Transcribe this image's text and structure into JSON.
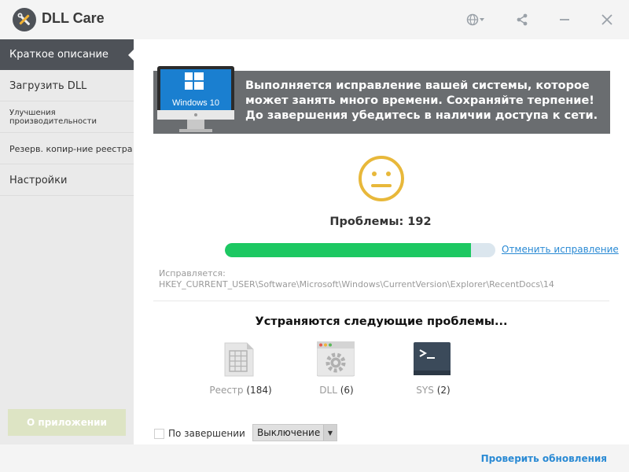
{
  "app": {
    "title": "DLL Care",
    "logo_icon": "wrench-screwdriver-icon"
  },
  "titlebar": {
    "language_icon": "globe-icon",
    "share_icon": "share-icon",
    "minimize_icon": "minimize-icon",
    "close_icon": "close-icon"
  },
  "sidebar": {
    "items": [
      {
        "label": "Краткое описание",
        "active": true
      },
      {
        "label": "Загрузить DLL",
        "active": false
      },
      {
        "label": "Улучшения производительности",
        "active": false
      },
      {
        "label": "Резерв. копир-ние реестра",
        "active": false
      },
      {
        "label": "Настройки",
        "active": false
      }
    ],
    "about_label": "О приложении"
  },
  "banner": {
    "monitor_text": "Windows 10",
    "message": "Выполняется исправление вашей системы, которое может занять много времени. Сохраняйте терпение! До завершения убедитесь в наличии доступа к сети."
  },
  "status": {
    "face_icon": "neutral-face-icon",
    "problems_label": "Проблемы: 192",
    "progress": 0.91,
    "cancel_label": "Отменить исправление",
    "fixing_label": "Исправляется:",
    "fixing_path": "HKEY_CURRENT_USER\\Software\\Microsoft\\Windows\\CurrentVersion\\Explorer\\RecentDocs\\14"
  },
  "issues": {
    "title": "Устраняются следующие проблемы...",
    "categories": [
      {
        "name": "Реестр",
        "count": "(184)",
        "icon": "registry-icon"
      },
      {
        "name": "DLL",
        "count": "(6)",
        "icon": "dll-gear-icon"
      },
      {
        "name": "SYS",
        "count": "(2)",
        "icon": "terminal-icon"
      }
    ]
  },
  "footer": {
    "on_complete_label": "По завершении",
    "action_value": "Выключение",
    "check_updates_label": "Проверить обновления"
  },
  "colors": {
    "accent": "#2a8ad4",
    "progress": "#1dc862",
    "sidebar_active": "#4e5258",
    "face": "#e8b83a"
  }
}
